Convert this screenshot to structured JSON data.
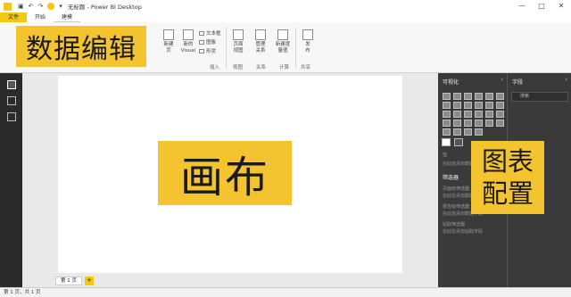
{
  "window": {
    "title": "无标题 - Power BI Desktop",
    "controls": [
      "—",
      "□",
      "✕"
    ]
  },
  "ribbon": {
    "tabs": [
      "文件",
      "开始",
      "建模"
    ],
    "items": [
      {
        "label": "新建\n页"
      },
      {
        "label": "新的\nVisual"
      },
      {
        "label": "页面\n视图"
      },
      {
        "label": "管理\n关系"
      },
      {
        "label": "新建度\n量值"
      },
      {
        "label": "发\n布"
      }
    ],
    "mini": [
      "文本框",
      "图像",
      "形状"
    ],
    "groups": [
      "插入",
      "视图",
      "关系",
      "计算",
      "共享"
    ]
  },
  "panes": {
    "visualizations": "可视化",
    "fields": "字段",
    "search_placeholder": "搜索",
    "values_label": "值",
    "values_hint": "在此处添加数据字段",
    "filters_title": "筛选器",
    "filter_hints": [
      "页面级筛选器",
      "在此处添加数据字段",
      "报告级筛选器",
      "在此处添加数据字段",
      "钻取筛选器",
      "在此处添加钻取字段"
    ]
  },
  "canvas": {
    "page_tab": "第 1 页",
    "add_page": "+"
  },
  "status": {
    "text": "第 1 页，共 1 页"
  },
  "overlays": {
    "data_edit": "数据编辑",
    "canvas": "画布",
    "chart_config_line1": "图表",
    "chart_config_line2": "配置"
  },
  "colors": {
    "accent": "#f2c811",
    "overlay": "#f4c430",
    "pane_bg": "#3a3a3a"
  }
}
